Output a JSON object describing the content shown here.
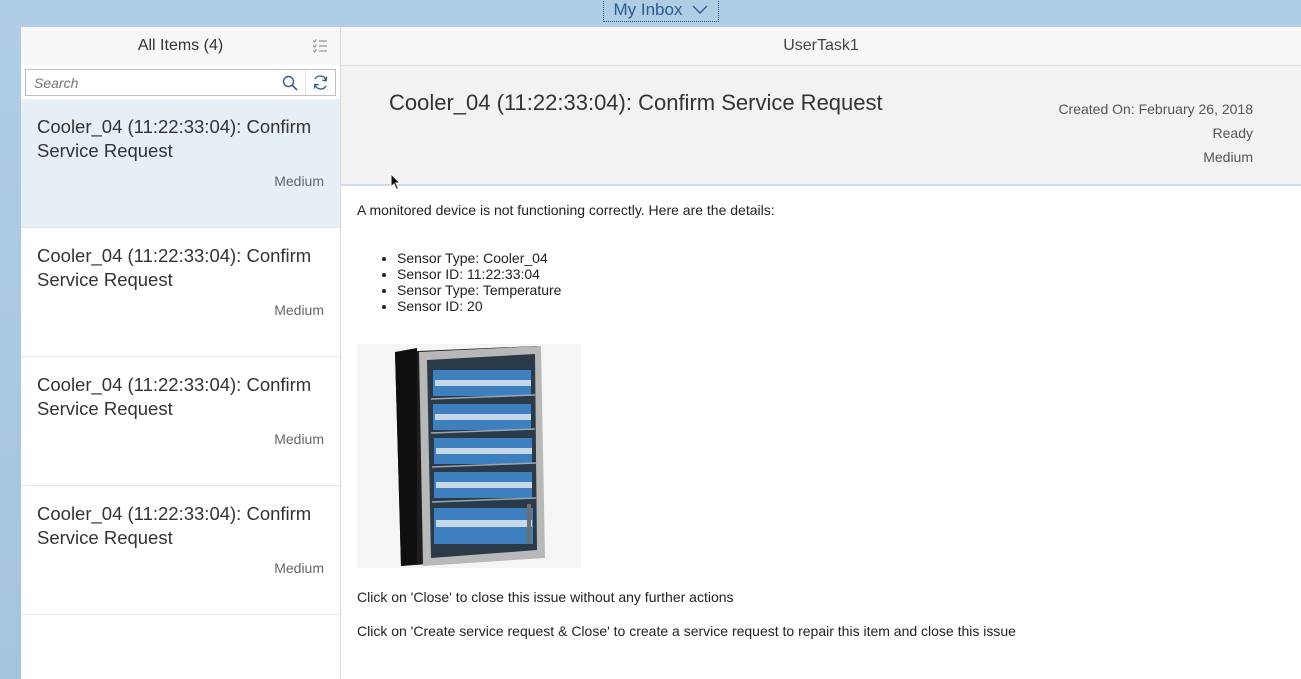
{
  "shell": {
    "title": "My Inbox"
  },
  "master": {
    "header": "All Items (4)",
    "search_placeholder": "Search",
    "items": [
      {
        "title": "Cooler_04 (11:22:33:04): Confirm Service Request",
        "priority": "Medium"
      },
      {
        "title": "Cooler_04 (11:22:33:04): Confirm Service Request",
        "priority": "Medium"
      },
      {
        "title": "Cooler_04 (11:22:33:04): Confirm Service Request",
        "priority": "Medium"
      },
      {
        "title": "Cooler_04 (11:22:33:04): Confirm Service Request",
        "priority": "Medium"
      }
    ]
  },
  "detail": {
    "header": "UserTask1",
    "title": "Cooler_04 (11:22:33:04): Confirm Service Request",
    "created_on": "Created On: February 26, 2018",
    "status": "Ready",
    "priority": "Medium",
    "intro": "A monitored device is not functioning correctly. Here are the details:",
    "details": [
      "Sensor Type: Cooler_04",
      "Sensor ID: 11:22:33:04",
      "Sensor Type: Temperature",
      "Sensor ID: 20"
    ],
    "instruction_close": "Click on 'Close' to close this issue without any further actions",
    "instruction_create": "Click on 'Create service request & Close' to create a service request to repair this item and close this issue"
  },
  "colors": {
    "accent": "#2b5c8f",
    "selected_bg": "#e6eef6",
    "shell_bg": "#a9c6e0"
  },
  "icons": [
    "chevron-down-icon",
    "filter-list-icon",
    "search-icon",
    "refresh-icon",
    "mouse-pointer-icon"
  ]
}
